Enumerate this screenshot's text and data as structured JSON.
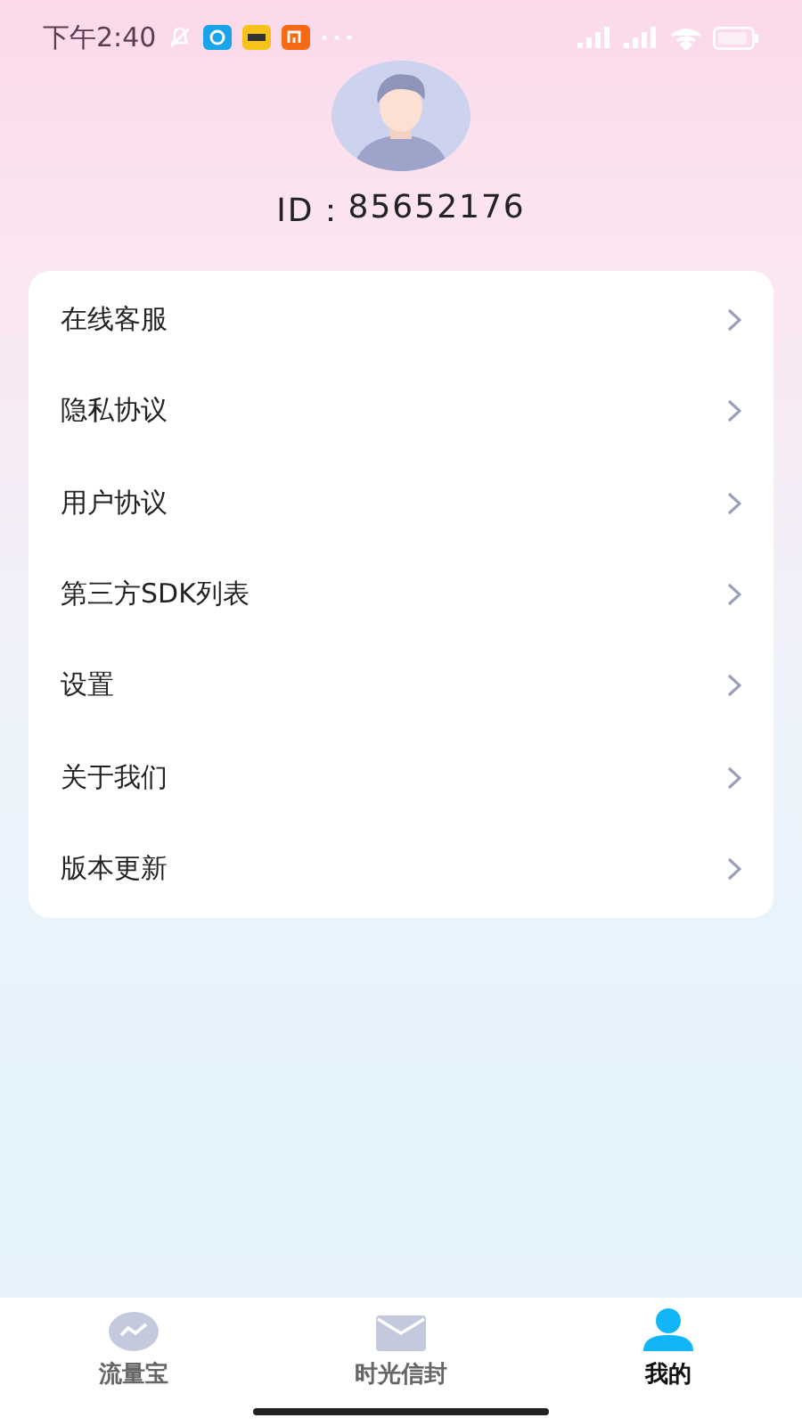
{
  "status_bar": {
    "time": "下午2:40"
  },
  "profile": {
    "id_label": "ID：",
    "id_value": "85652176"
  },
  "menu": [
    {
      "label": "在线客服"
    },
    {
      "label": "隐私协议"
    },
    {
      "label": "用户协议"
    },
    {
      "label": "第三方SDK列表"
    },
    {
      "label": "设置"
    },
    {
      "label": "关于我们"
    },
    {
      "label": "版本更新"
    }
  ],
  "tabs": [
    {
      "label": "流量宝",
      "kind": "chart",
      "selected": false
    },
    {
      "label": "时光信封",
      "kind": "mail",
      "selected": false
    },
    {
      "label": "我的",
      "kind": "person",
      "selected": true
    }
  ]
}
